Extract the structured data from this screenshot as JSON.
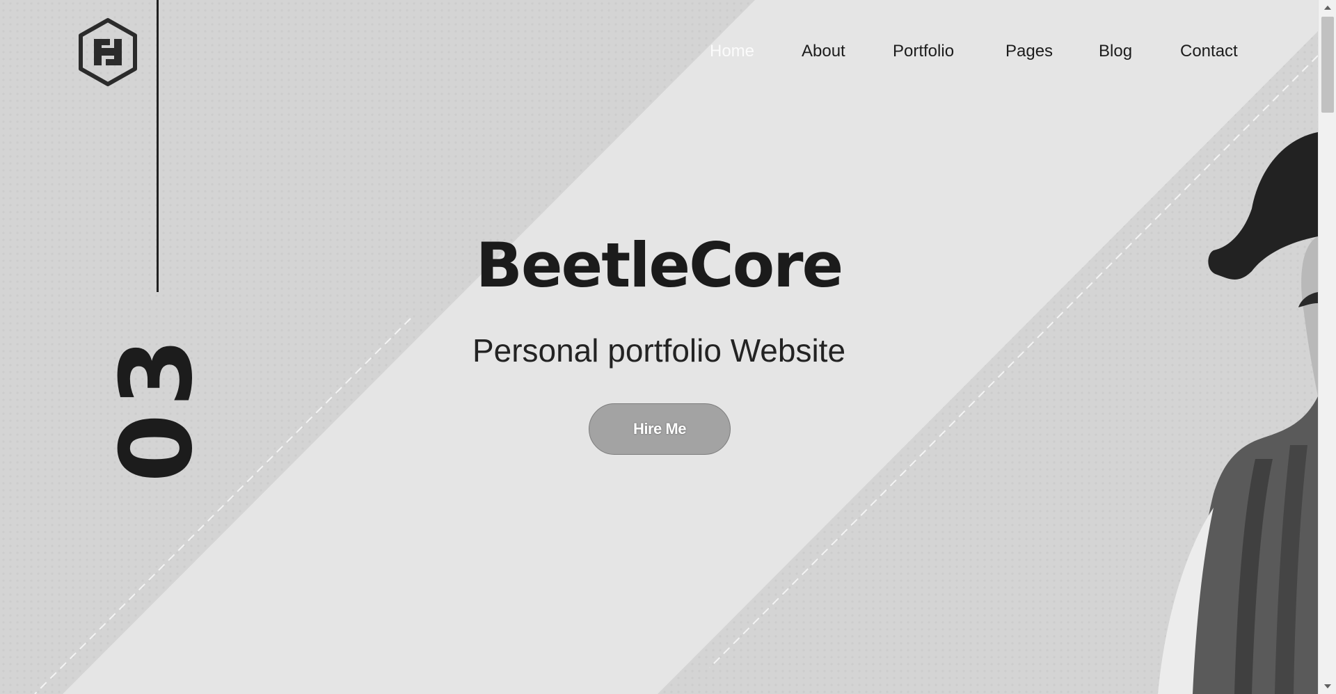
{
  "nav": {
    "items": [
      {
        "label": "Home",
        "active": true
      },
      {
        "label": "About",
        "active": false
      },
      {
        "label": "Portfolio",
        "active": false
      },
      {
        "label": "Pages",
        "active": false
      },
      {
        "label": "Blog",
        "active": false
      },
      {
        "label": "Contact",
        "active": false
      }
    ]
  },
  "hero": {
    "slide_number": "03",
    "title": "BeetleCore",
    "subtitle": "Personal portfolio Website",
    "button_label": "Hire Me"
  },
  "icons": {
    "logo": "hexagon-logo-icon",
    "scroll_up": "chevron-up-icon",
    "scroll_down": "chevron-down-icon"
  },
  "colors": {
    "background": "#e5e5e5",
    "band_dark": "#d3d3d3",
    "text": "#1c1c1c",
    "button": "#a3a3a3"
  }
}
